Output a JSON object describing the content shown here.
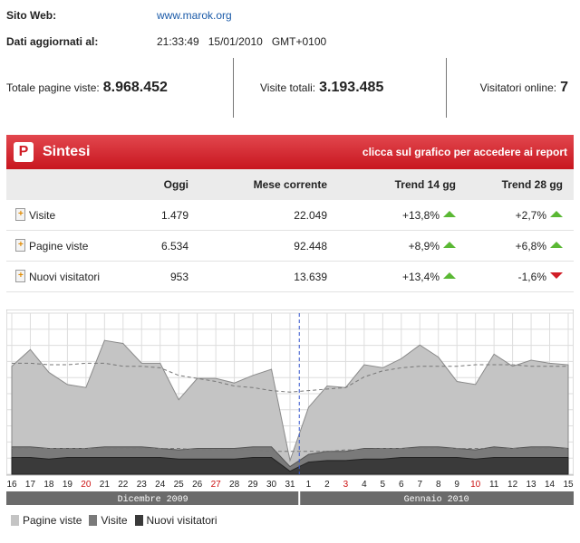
{
  "site": {
    "label": "Sito Web:",
    "url": "www.marok.org",
    "updated_label": "Dati aggiornati al:",
    "updated_time": "21:33:49",
    "updated_date": "15/01/2010",
    "updated_tz": "GMT+0100"
  },
  "stats": {
    "total_pages_label": "Totale pagine viste:",
    "total_pages": "8.968.452",
    "total_visits_label": "Visite totali:",
    "total_visits": "3.193.485",
    "online_label": "Visitatori online:",
    "online": "7"
  },
  "summary": {
    "logo_letter": "P",
    "title": "Sintesi",
    "report_link": "clicca sul grafico per accedere ai report",
    "columns": [
      "",
      "Oggi",
      "Mese corrente",
      "Trend 14 gg",
      "Trend 28 gg"
    ],
    "rows": [
      {
        "label": "Visite",
        "today": "1.479",
        "month": "22.049",
        "t14": "+13,8%",
        "t14_dir": "up",
        "t28": "+2,7%",
        "t28_dir": "up"
      },
      {
        "label": "Pagine viste",
        "today": "6.534",
        "month": "92.448",
        "t14": "+8,9%",
        "t14_dir": "up",
        "t28": "+6,8%",
        "t28_dir": "up"
      },
      {
        "label": "Nuovi visitatori",
        "today": "953",
        "month": "13.639",
        "t14": "+13,4%",
        "t14_dir": "up",
        "t28": "-1,6%",
        "t28_dir": "down"
      }
    ]
  },
  "chart_data": {
    "type": "area",
    "categories": [
      "16",
      "17",
      "18",
      "19",
      "20",
      "21",
      "22",
      "23",
      "24",
      "25",
      "26",
      "27",
      "28",
      "29",
      "30",
      "31",
      "1",
      "2",
      "3",
      "4",
      "5",
      "6",
      "7",
      "8",
      "9",
      "10",
      "11",
      "12",
      "13",
      "14",
      "15"
    ],
    "weekend_ticks": [
      "20",
      "27",
      "3",
      "10"
    ],
    "months": [
      {
        "name": "Dicembre 2009"
      },
      {
        "name": "Gennaio 2010"
      }
    ],
    "y_range": [
      0,
      1
    ],
    "grid": true,
    "legend_position": "bottom-left",
    "colors": {
      "pagine": "#c4c4c4",
      "visite": "#7a7a7a",
      "nuovi": "#3a3a3a",
      "weekend": "#cc1111",
      "divider": "#3355cc"
    },
    "series": [
      {
        "name": "Pagine viste",
        "values": [
          0.71,
          0.82,
          0.67,
          0.59,
          0.57,
          0.88,
          0.86,
          0.73,
          0.73,
          0.49,
          0.63,
          0.63,
          0.6,
          0.65,
          0.69,
          0.09,
          0.44,
          0.58,
          0.57,
          0.72,
          0.7,
          0.76,
          0.85,
          0.77,
          0.61,
          0.59,
          0.79,
          0.71,
          0.75,
          0.73,
          0.72
        ]
      },
      {
        "name": "Visite",
        "values": [
          0.18,
          0.18,
          0.17,
          0.17,
          0.17,
          0.18,
          0.18,
          0.18,
          0.17,
          0.16,
          0.17,
          0.17,
          0.17,
          0.18,
          0.18,
          0.05,
          0.13,
          0.15,
          0.15,
          0.17,
          0.17,
          0.17,
          0.18,
          0.18,
          0.17,
          0.16,
          0.18,
          0.17,
          0.18,
          0.18,
          0.17
        ]
      },
      {
        "name": "Nuovi visitatori",
        "values": [
          0.11,
          0.11,
          0.1,
          0.11,
          0.11,
          0.11,
          0.11,
          0.11,
          0.11,
          0.1,
          0.1,
          0.1,
          0.1,
          0.11,
          0.11,
          0.02,
          0.08,
          0.09,
          0.09,
          0.1,
          0.1,
          0.11,
          0.11,
          0.11,
          0.11,
          0.1,
          0.11,
          0.11,
          0.11,
          0.11,
          0.11
        ]
      }
    ],
    "trend_lines": [
      {
        "values": [
          0.73,
          0.73,
          0.72,
          0.72,
          0.73,
          0.73,
          0.71,
          0.71,
          0.7,
          0.65,
          0.63,
          0.61,
          0.58,
          0.57,
          0.55,
          0.54,
          0.55,
          0.56,
          0.57,
          0.64,
          0.68,
          0.7,
          0.71,
          0.71,
          0.71,
          0.72,
          0.72,
          0.72,
          0.71,
          0.71,
          0.71
        ]
      },
      {
        "values": [
          0.17,
          0.17,
          0.17,
          0.17,
          0.17,
          0.17,
          0.17,
          0.17,
          0.17,
          0.17,
          0.16,
          0.16,
          0.16,
          0.16,
          0.15,
          0.15,
          0.15,
          0.15,
          0.16,
          0.16,
          0.17,
          0.17,
          0.17,
          0.17,
          0.17,
          0.17,
          0.17,
          0.17,
          0.17,
          0.17,
          0.17
        ]
      }
    ]
  },
  "legend": [
    {
      "label": "Pagine viste",
      "color": "#c4c4c4"
    },
    {
      "label": "Visite",
      "color": "#7a7a7a"
    },
    {
      "label": "Nuovi visitatori",
      "color": "#3a3a3a"
    }
  ]
}
